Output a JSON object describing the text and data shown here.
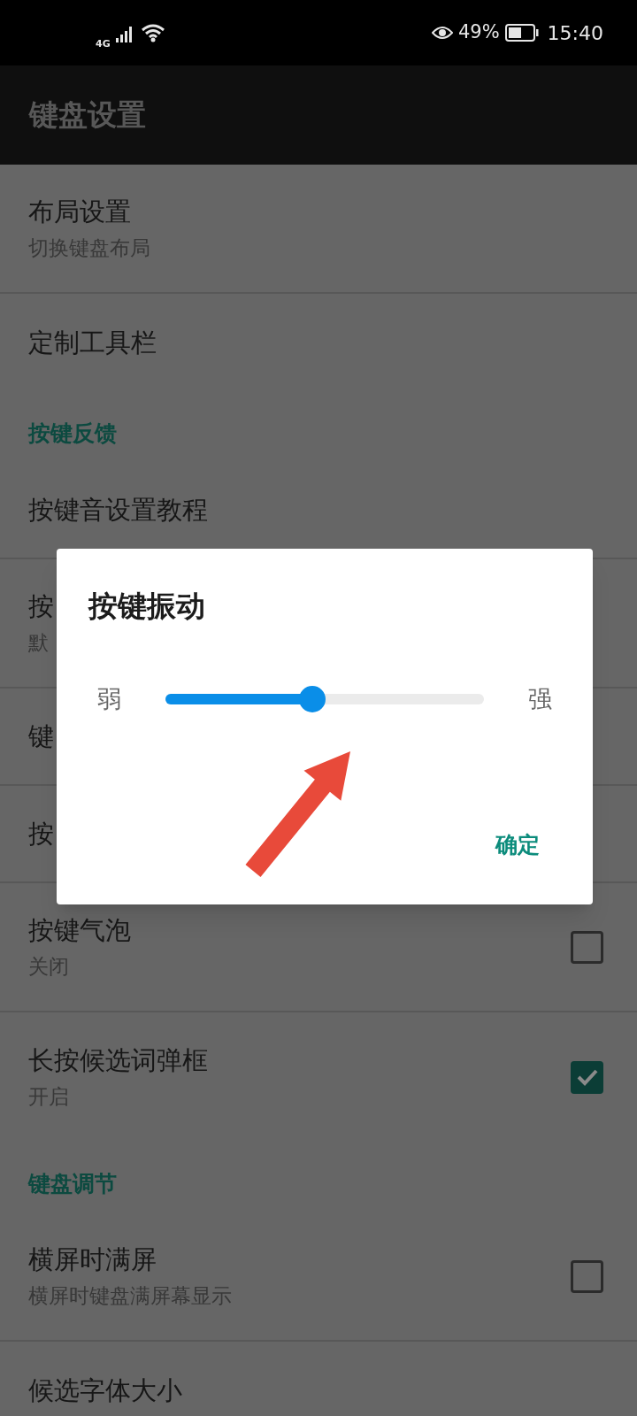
{
  "status_bar": {
    "network": "4G",
    "battery": "49%",
    "time": "15:40"
  },
  "app_bar": {
    "title": "键盘设置"
  },
  "settings": [
    {
      "kind": "item",
      "title": "布局设置",
      "subtitle": "切换键盘布局"
    },
    {
      "kind": "item",
      "title": "定制工具栏"
    },
    {
      "kind": "header",
      "title": "按键反馈"
    },
    {
      "kind": "item",
      "title": "按键音设置教程"
    },
    {
      "kind": "item",
      "title": "按",
      "subtitle": "默"
    },
    {
      "kind": "item",
      "title": "键"
    },
    {
      "kind": "item",
      "title": "按"
    },
    {
      "kind": "checkbox",
      "title": "按键气泡",
      "subtitle": "关闭",
      "checked": false
    },
    {
      "kind": "checkbox",
      "title": "长按候选词弹框",
      "subtitle": "开启",
      "checked": true
    },
    {
      "kind": "header",
      "title": "键盘调节"
    },
    {
      "kind": "checkbox",
      "title": "横屏时满屏",
      "subtitle": "横屏时键盘满屏幕显示",
      "checked": false
    },
    {
      "kind": "item",
      "title": "候选字体大小"
    }
  ],
  "dialog": {
    "title": "按键振动",
    "slider": {
      "min_label": "弱",
      "max_label": "强",
      "level": 0.46
    },
    "button": "确定"
  }
}
